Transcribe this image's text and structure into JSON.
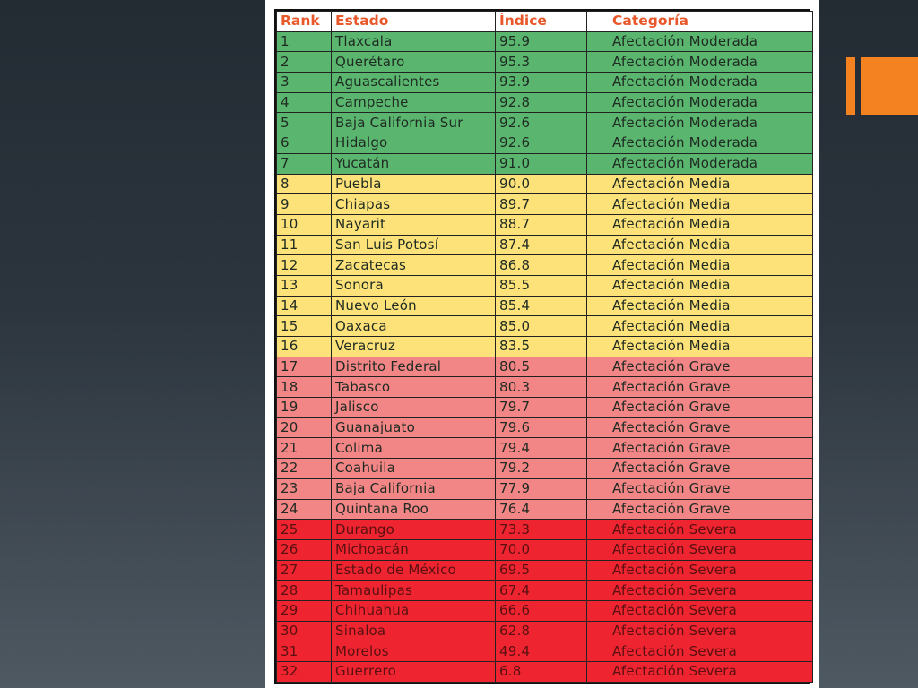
{
  "table": {
    "headers": {
      "rank": "Rank",
      "estado": "Estado",
      "indice": "Índice",
      "categoria": "Categoría"
    },
    "rows": [
      {
        "rank": "1",
        "estado": "Tlaxcala",
        "indice": "95.9",
        "categoria": "Afectación Moderada",
        "group": "moderada"
      },
      {
        "rank": "2",
        "estado": "Querétaro",
        "indice": "95.3",
        "categoria": "Afectación Moderada",
        "group": "moderada"
      },
      {
        "rank": "3",
        "estado": "Aguascalientes",
        "indice": "93.9",
        "categoria": "Afectación Moderada",
        "group": "moderada"
      },
      {
        "rank": "4",
        "estado": "Campeche",
        "indice": "92.8",
        "categoria": "Afectación Moderada",
        "group": "moderada"
      },
      {
        "rank": "5",
        "estado": "Baja California Sur",
        "indice": "92.6",
        "categoria": "Afectación Moderada",
        "group": "moderada"
      },
      {
        "rank": "6",
        "estado": "Hidalgo",
        "indice": "92.6",
        "categoria": "Afectación Moderada",
        "group": "moderada"
      },
      {
        "rank": "7",
        "estado": "Yucatán",
        "indice": "91.0",
        "categoria": "Afectación Moderada",
        "group": "moderada"
      },
      {
        "rank": "8",
        "estado": "Puebla",
        "indice": "90.0",
        "categoria": "Afectación Media",
        "group": "media"
      },
      {
        "rank": "9",
        "estado": "Chiapas",
        "indice": "89.7",
        "categoria": "Afectación Media",
        "group": "media"
      },
      {
        "rank": "10",
        "estado": "Nayarit",
        "indice": "88.7",
        "categoria": "Afectación Media",
        "group": "media"
      },
      {
        "rank": "11",
        "estado": "San Luis Potosí",
        "indice": "87.4",
        "categoria": "Afectación Media",
        "group": "media"
      },
      {
        "rank": "12",
        "estado": "Zacatecas",
        "indice": "86.8",
        "categoria": "Afectación Media",
        "group": "media"
      },
      {
        "rank": "13",
        "estado": "Sonora",
        "indice": "85.5",
        "categoria": "Afectación Media",
        "group": "media"
      },
      {
        "rank": "14",
        "estado": "Nuevo León",
        "indice": "85.4",
        "categoria": "Afectación Media",
        "group": "media"
      },
      {
        "rank": "15",
        "estado": "Oaxaca",
        "indice": "85.0",
        "categoria": "Afectación Media",
        "group": "media"
      },
      {
        "rank": "16",
        "estado": "Veracruz",
        "indice": "83.5",
        "categoria": "Afectación Media",
        "group": "media"
      },
      {
        "rank": "17",
        "estado": "Distrito Federal",
        "indice": "80.5",
        "categoria": "Afectación Grave",
        "group": "grave"
      },
      {
        "rank": "18",
        "estado": "Tabasco",
        "indice": "80.3",
        "categoria": "Afectación Grave",
        "group": "grave"
      },
      {
        "rank": "19",
        "estado": "Jalisco",
        "indice": "79.7",
        "categoria": "Afectación Grave",
        "group": "grave"
      },
      {
        "rank": "20",
        "estado": "Guanajuato",
        "indice": "79.6",
        "categoria": "Afectación Grave",
        "group": "grave"
      },
      {
        "rank": "21",
        "estado": "Colima",
        "indice": "79.4",
        "categoria": "Afectación Grave",
        "group": "grave"
      },
      {
        "rank": "22",
        "estado": "Coahuila",
        "indice": "79.2",
        "categoria": "Afectación Grave",
        "group": "grave"
      },
      {
        "rank": "23",
        "estado": "Baja California",
        "indice": "77.9",
        "categoria": "Afectación Grave",
        "group": "grave"
      },
      {
        "rank": "24",
        "estado": "Quintana Roo",
        "indice": "76.4",
        "categoria": "Afectación Grave",
        "group": "grave"
      },
      {
        "rank": "25",
        "estado": "Durango",
        "indice": "73.3",
        "categoria": "Afectación Severa",
        "group": "severa"
      },
      {
        "rank": "26",
        "estado": "Michoacán",
        "indice": "70.0",
        "categoria": "Afectación Severa",
        "group": "severa"
      },
      {
        "rank": "27",
        "estado": "Estado de México",
        "indice": "69.5",
        "categoria": "Afectación Severa",
        "group": "severa"
      },
      {
        "rank": "28",
        "estado": "Tamaulipas",
        "indice": "67.4",
        "categoria": "Afectación Severa",
        "group": "severa"
      },
      {
        "rank": "29",
        "estado": "Chihuahua",
        "indice": "66.6",
        "categoria": "Afectación Severa",
        "group": "severa"
      },
      {
        "rank": "30",
        "estado": "Sinaloa",
        "indice": "62.8",
        "categoria": "Afectación Severa",
        "group": "severa"
      },
      {
        "rank": "31",
        "estado": "Morelos",
        "indice": "49.4",
        "categoria": "Afectación Severa",
        "group": "severa"
      },
      {
        "rank": "32",
        "estado": "Guerrero",
        "indice": "6.8",
        "categoria": "Afectación Severa",
        "group": "severa"
      }
    ]
  },
  "colors": {
    "header_text": "#e8582a",
    "moderada": "#5ab56e",
    "media": "#fde27a",
    "grave": "#f28585",
    "severa": "#ee2530",
    "accent": "#f58220"
  }
}
